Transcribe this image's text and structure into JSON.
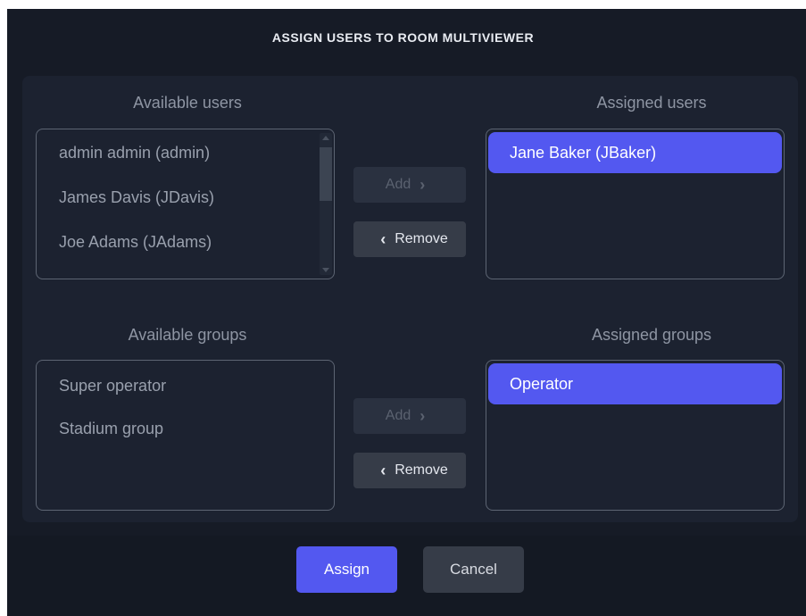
{
  "dialog": {
    "title": "ASSIGN USERS TO ROOM MULTIVIEWER"
  },
  "users": {
    "available_label": "Available users",
    "assigned_label": "Assigned users",
    "available": [
      "admin admin (admin)",
      "James Davis (JDavis)",
      "Joe Adams (JAdams)"
    ],
    "assigned": [
      "Jane Baker (JBaker)"
    ],
    "add_label": "Add",
    "remove_label": "Remove"
  },
  "groups": {
    "available_label": "Available groups",
    "assigned_label": "Assigned groups",
    "available": [
      "Super operator",
      "Stadium group"
    ],
    "assigned": [
      "Operator"
    ],
    "add_label": "Add",
    "remove_label": "Remove"
  },
  "footer": {
    "assign_label": "Assign",
    "cancel_label": "Cancel"
  },
  "colors": {
    "accent": "#5358f0",
    "background": "#161b26",
    "panel": "#1c2230"
  }
}
